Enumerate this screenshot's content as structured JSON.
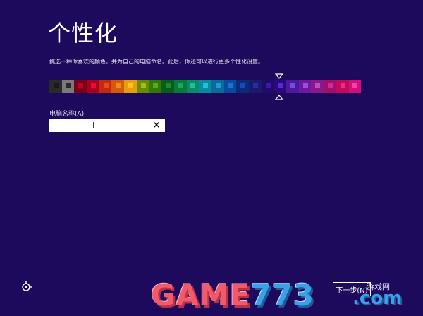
{
  "page": {
    "title": "个性化",
    "subtitle": "挑选一种你喜欢的颜色，并为自己的电脑命名。此后，你还可以进行更多个性化设置。"
  },
  "colors": {
    "background": "#1e0a5c",
    "selected_index": 18,
    "swatches": [
      {
        "outer": "#2a2a2a",
        "inner": "#1a1a1a"
      },
      {
        "outer": "#7a7a7a",
        "inner": "#2a2a2a"
      },
      {
        "outer": "#7a0016",
        "inner": "#c1002a"
      },
      {
        "outer": "#a8001f",
        "inner": "#e0103a"
      },
      {
        "outer": "#c2290f",
        "inner": "#ea4a1a"
      },
      {
        "outer": "#d4590a",
        "inner": "#f08a1a"
      },
      {
        "outer": "#e3a00a",
        "inner": "#ffc020"
      },
      {
        "outer": "#6b8a00",
        "inner": "#9cc21a"
      },
      {
        "outer": "#2f7a00",
        "inner": "#58a81a"
      },
      {
        "outer": "#0a5c1a",
        "inner": "#1a8a2a"
      },
      {
        "outer": "#0a7a3a",
        "inner": "#18a858"
      },
      {
        "outer": "#0a8a6a",
        "inner": "#20c09a"
      },
      {
        "outer": "#0a8aa0",
        "inner": "#20c0d8"
      },
      {
        "outer": "#0a6a9a",
        "inner": "#1a9ad8"
      },
      {
        "outer": "#0a4a9a",
        "inner": "#1a70d8"
      },
      {
        "outer": "#0a2a7a",
        "inner": "#1a4ab8"
      },
      {
        "outer": "#1a1a6a",
        "inner": "#2a2aa8"
      },
      {
        "outer": "#200a6a",
        "inner": "#3a1aa8"
      },
      {
        "outer": "#2a0a7a",
        "inner": "#5a2ad0"
      },
      {
        "outer": "#4a1a9a",
        "inner": "#7a4ae0"
      },
      {
        "outer": "#6a1a9a",
        "inner": "#a04ae0"
      },
      {
        "outer": "#8a1a8a",
        "inner": "#c04ac8"
      },
      {
        "outer": "#a0106a",
        "inner": "#d02a9a"
      },
      {
        "outer": "#c00a5a",
        "inner": "#f02a8a"
      },
      {
        "outer": "#d0107a",
        "inner": "#ff3aaa"
      }
    ]
  },
  "computer_name": {
    "label": "电脑名称(A)",
    "value": "",
    "placeholder": "",
    "clear_glyph": "✕"
  },
  "footer": {
    "next_label": "下一步(N)",
    "watermark_game": "GAME",
    "watermark_digits": "773",
    "watermark_com": ".com",
    "watermark_site": "游戏网"
  }
}
